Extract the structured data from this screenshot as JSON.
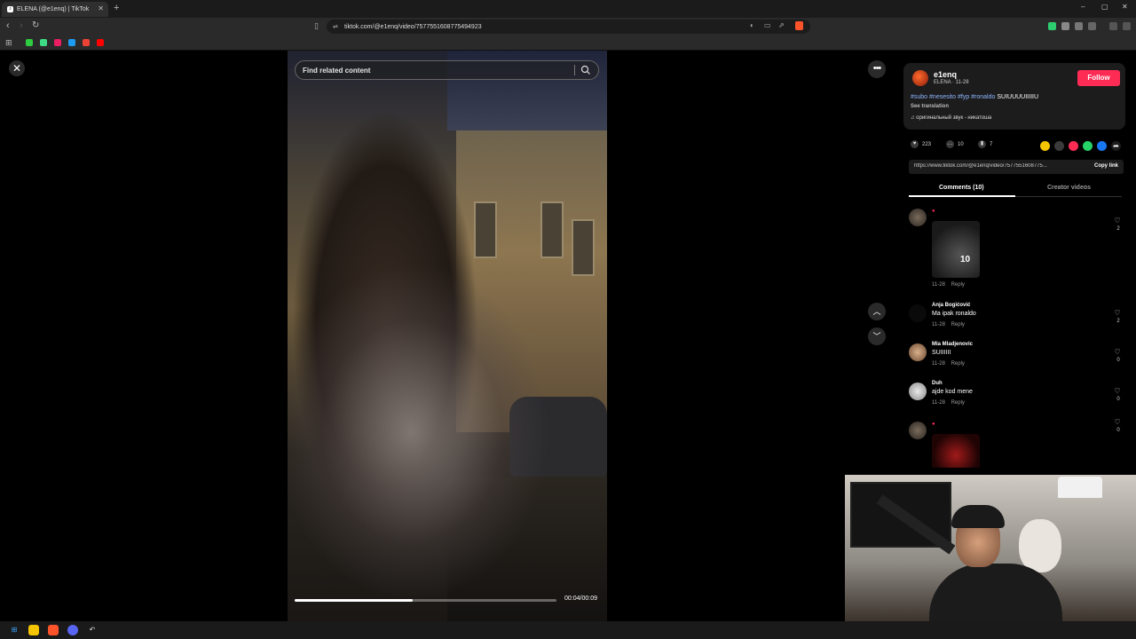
{
  "browser": {
    "tab_title": "ELENA (@e1enq) | TikTok",
    "url": "tiktok.com/@e1enq/video/7577551608775494923",
    "new_tab_symbol": "+",
    "window_controls": [
      "–",
      "▢",
      "✕"
    ]
  },
  "video": {
    "search_placeholder": "Find related content",
    "time": "00:04/00:09",
    "progress": 0.45
  },
  "post": {
    "username": "e1enq",
    "subline": "ELENA · 11-28",
    "follow_label": "Follow",
    "hashtags": [
      "#subo",
      "#nesesito",
      "#fyp",
      "#ronaldo"
    ],
    "caption_tail": "SUIUUUUIIIIIU",
    "see_translation": "See translation",
    "sound": "оригинальный звук - никатоша",
    "likes": "223",
    "comments": "10",
    "saves": "7",
    "share_link": "https://www.tiktok.com/@e1enq/video/7577551608775...",
    "copy_link_label": "Copy link",
    "share_colors": [
      "#f5c400",
      "#3a3a3a",
      "#fe2c55",
      "#25d366",
      "#1877f2",
      "#1c1c1c"
    ]
  },
  "tabs": {
    "comments_label": "Comments (10)",
    "creator_label": "Creator videos"
  },
  "comments": [
    {
      "name": "",
      "text": "",
      "date": "11-28",
      "reply": "Reply",
      "likes": "2",
      "sticker_number": "10"
    },
    {
      "name": "Anja Bogićović",
      "text": "Ma ipak ronaldo",
      "date": "11-28",
      "reply": "Reply",
      "likes": "2"
    },
    {
      "name": "Mia Mladjenovic",
      "text": "SUIIIIII",
      "date": "11-28",
      "reply": "Reply",
      "likes": "0"
    },
    {
      "name": "Duh",
      "text": "ajde kod mene",
      "date": "11-28",
      "reply": "Reply",
      "likes": "0"
    },
    {
      "name": "",
      "text": "",
      "date": "",
      "reply": "",
      "likes": "0"
    }
  ]
}
